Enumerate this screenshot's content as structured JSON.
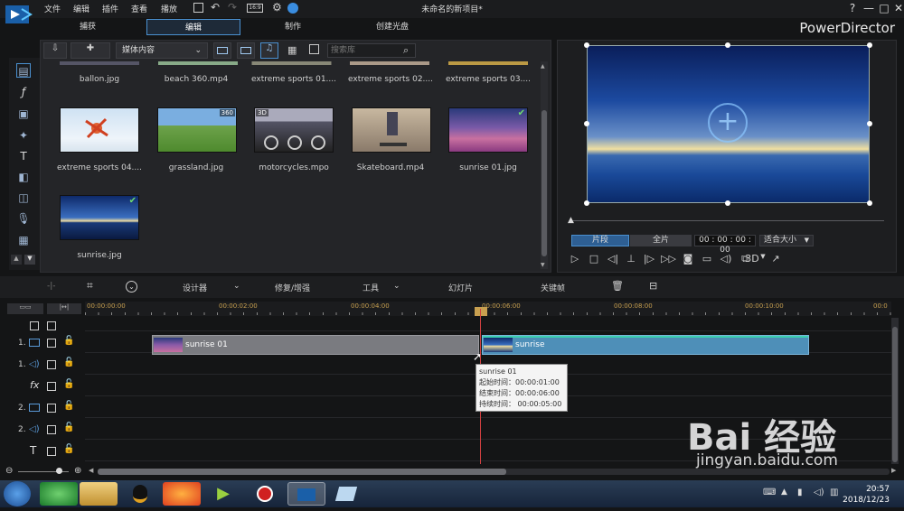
{
  "window": {
    "menu": [
      "文件",
      "编辑",
      "插件",
      "查看",
      "播放"
    ],
    "title": "未命名的新项目*",
    "brand": "PowerDirector",
    "help": "?",
    "minimize": "—",
    "maximize": "□",
    "close": "✕"
  },
  "modes": [
    "捕获",
    "编辑",
    "制作",
    "创建光盘"
  ],
  "library": {
    "dropdown": "媒体内容",
    "search_placeholder": "搜索库",
    "row0": [
      "ballon.jpg",
      "beach 360.mp4",
      "extreme sports 01....",
      "extreme sports 02....",
      "extreme sports 03...."
    ],
    "items": [
      {
        "name": "extreme sports 04....",
        "badge": ""
      },
      {
        "name": "grassland.jpg",
        "badge": "360"
      },
      {
        "name": "motorcycles.mpo",
        "badge": "3D"
      },
      {
        "name": "Skateboard.mp4",
        "badge": ""
      },
      {
        "name": "sunrise 01.jpg",
        "badge": "✔"
      },
      {
        "name": "sunrise.jpg",
        "badge": "✔"
      }
    ]
  },
  "preview": {
    "clip_tab": "片段",
    "full_tab": "全片",
    "timecode": "00 : 00 : 00 : 00",
    "fit": "适合大小",
    "mode3d": "3D"
  },
  "timeline_toolbar": {
    "designer": "设计器",
    "fix": "修复/增强",
    "tools": "工具",
    "slideshow": "幻灯片",
    "keyframe": "关键帧"
  },
  "ruler": [
    "00:00:00:00",
    "00:00:02:00",
    "00:00:04:00",
    "00:00:06:00",
    "00:00:08:00",
    "00:00:10:00",
    "00:0"
  ],
  "tracks": {
    "t1": "1.",
    "t1a": "1.",
    "t2": "2.",
    "t2a": "2.",
    "fx": "fx",
    "text": "T"
  },
  "clips": {
    "clip1": "sunrise 01",
    "clip2": "sunrise"
  },
  "tooltip": {
    "name": "sunrise 01",
    "start": "起始时间：00:00:01:00",
    "end": "结束时间：00:00:06:00",
    "duration": "持续时间：  00:00:05:00"
  },
  "taskbar": {
    "time": "20:57",
    "date": "2018/12/23"
  },
  "watermark": {
    "logo": "Bai 经验",
    "url": "jingyan.baidu.com"
  }
}
